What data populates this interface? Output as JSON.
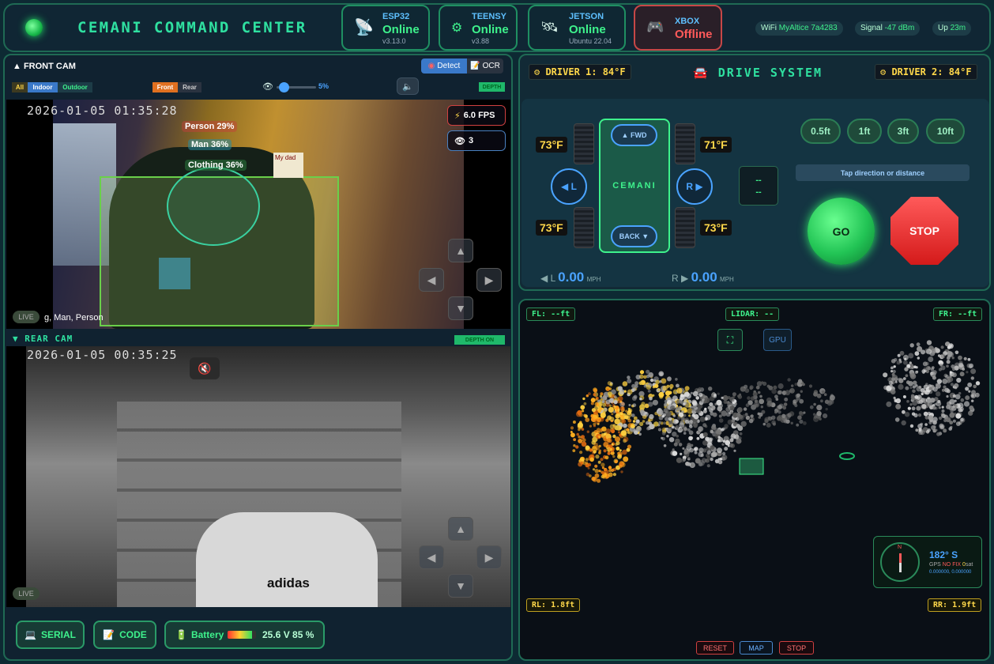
{
  "header": {
    "title": "CEMANI COMMAND CENTER",
    "esp32": {
      "name": "ESP32",
      "status": "Online",
      "version": "v3.13.0"
    },
    "teensy": {
      "name": "TEENSY",
      "status": "Online",
      "version": "v3.88"
    },
    "jetson": {
      "name": "JETSON",
      "status": "Online",
      "version": "Ubuntu 22.04"
    },
    "xbox": {
      "name": "XBOX",
      "status": "Offline"
    },
    "wifi_label": "WiFi",
    "wifi_value": "MyAltice 7a4283",
    "signal_label": "Signal",
    "signal_value": "-47 dBm",
    "uptime_label": "Up",
    "uptime_value": "23m"
  },
  "front_cam": {
    "title": "▲ FRONT CAM",
    "detect_label": "Detect",
    "ocr_label": "OCR",
    "filters": [
      "All",
      "Indoor",
      "Outdoor"
    ],
    "cam_select": [
      "Front",
      "Rear"
    ],
    "slider_value": "5%",
    "depth_label": "DEPTH",
    "timestamp": "2026-01-05 01:35:28",
    "fps": "6.0 FPS",
    "eye_count": "3",
    "detections": [
      "Person 29%",
      "Man 36%",
      "Clothing 36%"
    ],
    "live_label": "LIVE",
    "caption": "g, Man, Person",
    "handwritten": "My dad"
  },
  "rear_cam": {
    "title": "▼ REAR CAM",
    "depth_label": "DEPTH ON",
    "timestamp": "2026-01-05 00:35:25",
    "live_label": "LIVE",
    "brand": "adidas"
  },
  "bottom_bar": {
    "serial_label": "SERIAL",
    "code_label": "CODE",
    "battery_label": "Battery",
    "battery_level": 0.85,
    "battery_value": "25.6 V 85 %"
  },
  "drive": {
    "title": "DRIVE SYSTEM",
    "driver1": "DRIVER 1: 84°F",
    "driver2": "DRIVER 2: 84°F",
    "temps": {
      "fl": "73°F",
      "fr": "71°F",
      "rl": "73°F",
      "rr": "73°F"
    },
    "fwd_label": "▲ FWD",
    "back_label": "BACK ▼",
    "robot_name": "CEMANI",
    "left_label": "◀ L",
    "right_label": "R ▶",
    "readout_line1": "--",
    "readout_line2": "--",
    "distances": [
      "0.5ft",
      "1ft",
      "3ft",
      "10ft"
    ],
    "hint": "Tap direction or distance",
    "go_label": "GO",
    "stop_label": "STOP",
    "left_speed_label": "◀ L",
    "left_speed": "0.00",
    "right_speed_label": "R ▶",
    "right_speed": "0.00",
    "speed_unit": "MPH"
  },
  "lidar": {
    "fl": "FL: --ft",
    "fr": "FR: --ft",
    "center": "LIDAR: --",
    "rl": "RL: 1.8ft",
    "rr": "RR: 1.9ft",
    "gpu_label": "GPU",
    "heading": "182° S",
    "gps_label": "GPS",
    "gps_fix": "NO FIX",
    "gps_sat": "0",
    "gps_sat_unit": "sat",
    "gps_coords": "0.000000, 0.000000",
    "compass_n": "N",
    "reset_label": "RESET",
    "map_label": "MAP",
    "stop_label": "STOP"
  },
  "colors": {
    "accent": "#2fe0a0",
    "online": "#3ef28c",
    "offline": "#ff5a5a",
    "temp": "#ffd84a"
  }
}
